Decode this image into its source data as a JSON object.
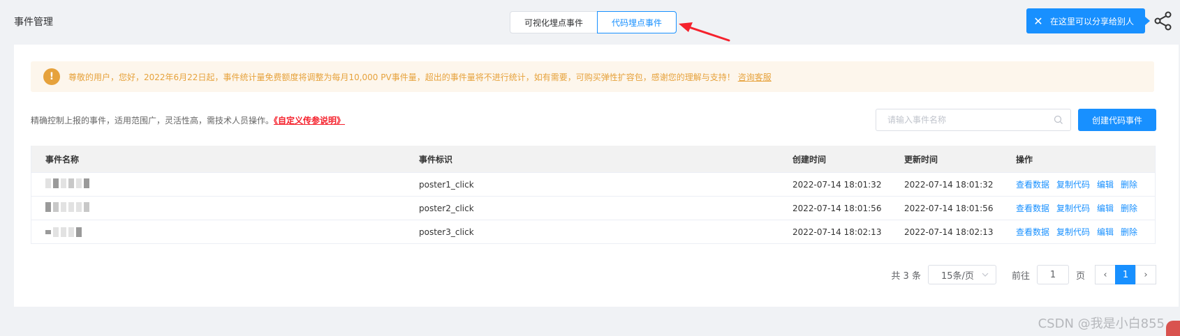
{
  "header": {
    "title": "事件管理",
    "tabs": [
      {
        "label": "可视化埋点事件",
        "active": false
      },
      {
        "label": "代码埋点事件",
        "active": true
      }
    ],
    "tip_text": "在这里可以分享给别人",
    "close_glyph": "✕"
  },
  "notice": {
    "icon_glyph": "!",
    "text": "尊敬的用户，您好，2022年6月22日起，事件统计量免费额度将调整为每月10,000 PV事件量，超出的事件量将不进行统计，如有需要，可购买弹性扩容包，感谢您的理解与支持！",
    "link": "咨询客服"
  },
  "description": {
    "text": "精确控制上报的事件，适用范围广，灵活性高，需技术人员操作。",
    "link": "《自定义传参说明》"
  },
  "search": {
    "placeholder": "请输入事件名称",
    "value": ""
  },
  "create_button": "创建代码事件",
  "table": {
    "headers": [
      "事件名称",
      "事件标识",
      "创建时间",
      "更新时间",
      "操作"
    ],
    "rows": [
      {
        "id": "poster1_click",
        "created": "2022-07-14 18:01:32",
        "updated": "2022-07-14 18:01:32"
      },
      {
        "id": "poster2_click",
        "created": "2022-07-14 18:01:56",
        "updated": "2022-07-14 18:01:56"
      },
      {
        "id": "poster3_click",
        "created": "2022-07-14 18:02:13",
        "updated": "2022-07-14 18:02:13"
      }
    ],
    "actions": [
      "查看数据",
      "复制代码",
      "编辑",
      "删除"
    ]
  },
  "pagination": {
    "total": "共 3 条",
    "page_size": "15条/页",
    "goto": "前往",
    "goto_value": "1",
    "page_unit": "页",
    "prev": "‹",
    "current": "1",
    "next": "›"
  },
  "watermark": "CSDN @我是小白855",
  "colors": {
    "primary": "#1890ff",
    "warning": "#e6a23c",
    "annotation": "#f5222d"
  }
}
